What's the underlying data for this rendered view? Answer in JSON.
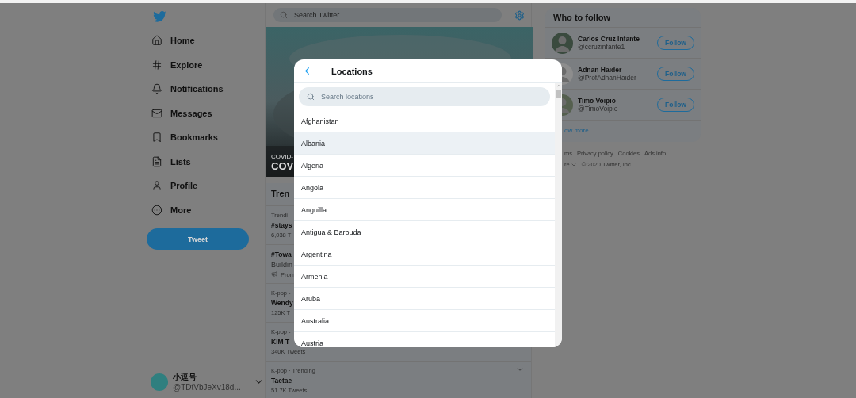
{
  "sidebar": {
    "nav": [
      {
        "label": "Home"
      },
      {
        "label": "Explore"
      },
      {
        "label": "Notifications"
      },
      {
        "label": "Messages"
      },
      {
        "label": "Bookmarks"
      },
      {
        "label": "Lists"
      },
      {
        "label": "Profile"
      },
      {
        "label": "More"
      }
    ],
    "tweet_button": "Tweet",
    "account": {
      "name": "小逗号",
      "handle": "@TDtVbJeXv18d..."
    }
  },
  "main": {
    "search": {
      "placeholder": "Search Twitter"
    },
    "banner": {
      "category": "COVID-",
      "title": "COV"
    },
    "trends": {
      "title": "Tren",
      "items": [
        {
          "kind": "trend",
          "context": "Trendi",
          "name": "#stays",
          "count": "6,038 T"
        },
        {
          "kind": "promoted",
          "name": "#Towa",
          "description": "Buildin",
          "promoted": "Prom"
        },
        {
          "kind": "trend",
          "context": "K-pop -",
          "name": "Wendy",
          "count": "125K T"
        },
        {
          "kind": "trend",
          "context": "K-pop -",
          "name": "KIM T",
          "count": "340K Tweets"
        },
        {
          "kind": "trend",
          "context": "K-pop · Trending",
          "name": "Taetae",
          "count": "51.7K Tweets",
          "menu": true
        }
      ]
    }
  },
  "who_to_follow": {
    "title": "Who to follow",
    "users": [
      {
        "name": "Carlos Cruz Infante",
        "handle": "@ccruzinfante1",
        "button": "Follow"
      },
      {
        "name": "Adnan Haider",
        "handle": "@ProfAdnanHaider",
        "button": "Follow"
      },
      {
        "name": "Timo Voipio",
        "handle": "@TimoVoipio",
        "button": "Follow"
      }
    ],
    "show_more": "ow more"
  },
  "footer": {
    "links": [
      "ms",
      "Privacy policy",
      "Cookies",
      "Ads info"
    ],
    "more": "re",
    "copyright": "© 2020 Twitter, Inc."
  },
  "modal": {
    "title": "Locations",
    "search": {
      "placeholder": "Search locations"
    },
    "locations": [
      {
        "name": "Afghanistan",
        "selected": false
      },
      {
        "name": "Albania",
        "selected": true
      },
      {
        "name": "Algeria",
        "selected": false
      },
      {
        "name": "Angola",
        "selected": false
      },
      {
        "name": "Anguilla",
        "selected": false
      },
      {
        "name": "Antigua & Barbuda",
        "selected": false
      },
      {
        "name": "Argentina",
        "selected": false
      },
      {
        "name": "Armenia",
        "selected": false
      },
      {
        "name": "Aruba",
        "selected": false
      },
      {
        "name": "Australia",
        "selected": false
      },
      {
        "name": "Austria",
        "selected": false
      }
    ]
  }
}
